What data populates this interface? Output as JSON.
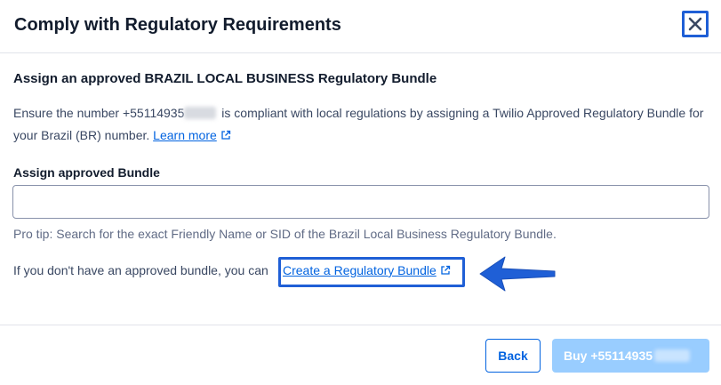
{
  "dialog": {
    "title": "Comply with Regulatory Requirements"
  },
  "body": {
    "heading": "Assign an approved BRAZIL LOCAL BUSINESS Regulatory Bundle",
    "desc_prefix": "Ensure the number +55114935",
    "desc_suffix": " is compliant with local regulations by assigning a Twilio Approved Regulatory Bundle for your Brazil (BR) number. ",
    "learn_more": "Learn more",
    "field_label": "Assign approved Bundle",
    "field_value": "",
    "help_text": "Pro tip: Search for the exact Friendly Name or SID of the Brazil Local Business Regulatory Bundle.",
    "create_prefix": "If you don't have an approved bundle, you can ",
    "create_link": "Create a Regulatory Bundle"
  },
  "footer": {
    "back_label": "Back",
    "buy_label": "Buy +55114935"
  },
  "colors": {
    "accent": "#1f5fd6",
    "link": "#0263e0",
    "disabled_button": "#99cdff"
  },
  "icons": {
    "close": "close-icon",
    "external_link": "external-link-icon",
    "annotation_arrow": "arrow-left-icon"
  }
}
